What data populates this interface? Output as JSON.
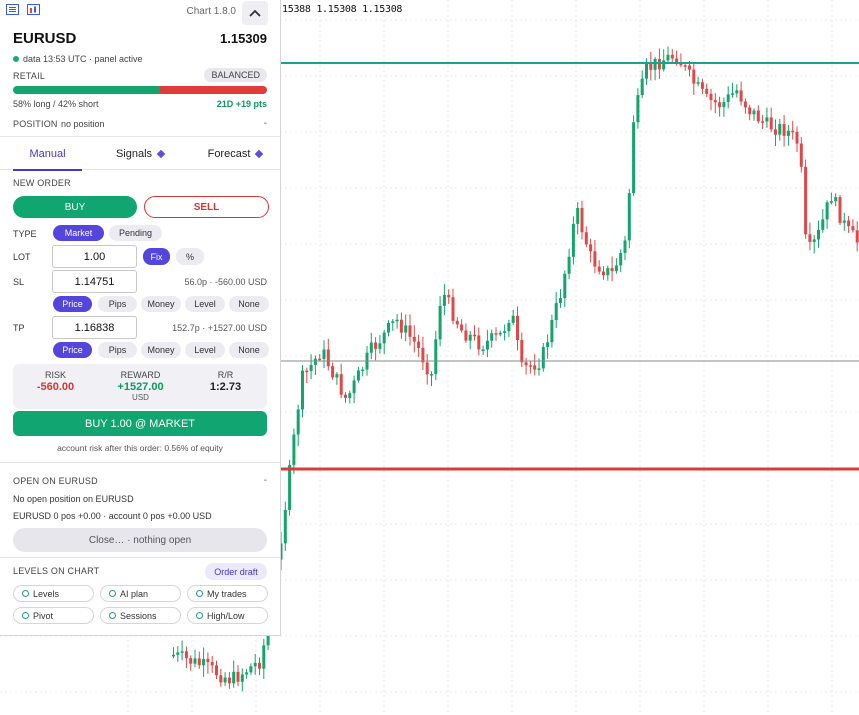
{
  "chart": {
    "ohlc_readout": "15388 1.15308 1.15308",
    "colors": {
      "up": "#14a46c",
      "down": "#e04848",
      "line_green": "#1aa38c",
      "line_red": "#dc3b3b",
      "line_gray": "#8a8a8a",
      "grid": "#e9e9e9"
    }
  },
  "panel": {
    "version": "Chart 1.8.0",
    "symbol": "EURUSD",
    "price": "1.15309",
    "data_status": "data 13:53 UTC · panel active",
    "retail_label": "RETAIL",
    "balance_badge": "BALANCED",
    "long_pct": 0.58,
    "sentiment_text": "58% long / 42% short",
    "sentiment_change": "21D +19 pts",
    "position_label": "POSITION",
    "position_value": "no position",
    "position_dash": "-",
    "tabs": [
      {
        "label": "Manual"
      },
      {
        "label": "Signals"
      },
      {
        "label": "Forecast"
      }
    ],
    "new_order_label": "NEW ORDER",
    "buy_label": "BUY",
    "sell_label": "SELL",
    "type_label": "TYPE",
    "type_options": [
      "Market",
      "Pending"
    ],
    "lot_label": "LOT",
    "lot_value": "1.00",
    "lot_modes": [
      "Fix",
      "%"
    ],
    "sl_label": "SL",
    "sl_value": "1.14751",
    "sl_note": "56.0p · -560.00 USD",
    "tp_label": "TP",
    "tp_value": "1.16838",
    "tp_note": "152.7p · +1527.00 USD",
    "mode_options": [
      "Price",
      "Pips",
      "Money",
      "Level",
      "None"
    ],
    "risk_label": "RISK",
    "risk_value": "-560.00",
    "reward_label": "REWARD",
    "reward_value": "+1527.00",
    "reward_unit": "USD",
    "rr_label": "R/R",
    "rr_value": "1:2.73",
    "market_button": "BUY 1.00 @ MARKET",
    "account_risk": "account risk after this order: 0.56% of equity",
    "open_on_label": "OPEN ON EURUSD",
    "open_dash": "-",
    "no_open_text": "No open position on EURUSD",
    "account_text": "EURUSD 0 pos +0.00 · account 0 pos +0.00 USD",
    "close_button": "Close… · nothing open",
    "levels_label": "LEVELS ON CHART",
    "order_draft": "Order draft",
    "chips": [
      "Levels",
      "AI plan",
      "My trades",
      "Pivot",
      "Sessions",
      "High/Low"
    ]
  }
}
